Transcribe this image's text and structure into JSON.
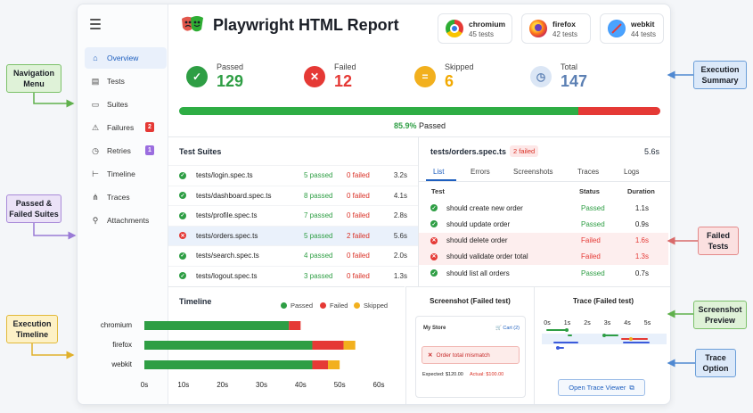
{
  "app": {
    "title": "Playwright HTML Report"
  },
  "sidebar": {
    "items": [
      {
        "label": "Overview",
        "icon": "home-icon",
        "active": true
      },
      {
        "label": "Tests",
        "icon": "clipboard-icon"
      },
      {
        "label": "Suites",
        "icon": "folder-icon"
      },
      {
        "label": "Failures",
        "icon": "alert-icon",
        "badge": "2",
        "badge_color": "#e53935"
      },
      {
        "label": "Retries",
        "icon": "clock-icon",
        "badge": "1",
        "badge_color": "#9b6ddf"
      },
      {
        "label": "Timeline",
        "icon": "timeline-icon"
      },
      {
        "label": "Traces",
        "icon": "trace-icon"
      },
      {
        "label": "Attachments",
        "icon": "paperclip-icon"
      }
    ]
  },
  "browsers": [
    {
      "name": "chromium",
      "count": "45 tests",
      "icon": "chrome-icon"
    },
    {
      "name": "firefox",
      "count": "42 tests",
      "icon": "firefox-icon"
    },
    {
      "name": "webkit",
      "count": "44 tests",
      "icon": "safari-icon"
    }
  ],
  "summary": {
    "passed": {
      "label": "Passed",
      "value": "129",
      "color": "#2e9e44"
    },
    "failed": {
      "label": "Failed",
      "value": "12",
      "color": "#e53935"
    },
    "skipped": {
      "label": "Skipped",
      "value": "6",
      "color": "#f2a900"
    },
    "total": {
      "label": "Total",
      "value": "147",
      "color": "#5b7fb3"
    }
  },
  "progress": {
    "passed_fraction": 0.852,
    "failed_fraction": 0.174,
    "percent_text": "85.9%",
    "label": "Passed"
  },
  "suites": {
    "title": "Test Suites",
    "rows": [
      {
        "name": "tests/login.spec.ts",
        "passed": "5 passed",
        "failed": "0 failed",
        "duration": "3.2s",
        "status": "pass"
      },
      {
        "name": "tests/dashboard.spec.ts",
        "passed": "8 passed",
        "failed": "0 failed",
        "duration": "4.1s",
        "status": "pass"
      },
      {
        "name": "tests/profile.spec.ts",
        "passed": "7 passed",
        "failed": "0 failed",
        "duration": "2.8s",
        "status": "pass"
      },
      {
        "name": "tests/orders.spec.ts",
        "passed": "5 passed",
        "failed": "2 failed",
        "duration": "5.6s",
        "status": "fail",
        "selected": true
      },
      {
        "name": "tests/search.spec.ts",
        "passed": "4 passed",
        "failed": "0 failed",
        "duration": "2.0s",
        "status": "pass"
      },
      {
        "name": "tests/logout.spec.ts",
        "passed": "3 passed",
        "failed": "0 failed",
        "duration": "1.3s",
        "status": "pass"
      }
    ]
  },
  "detail": {
    "file": "tests/orders.spec.ts",
    "badge": "2 failed",
    "duration": "5.6s",
    "tabs": [
      "List",
      "Errors",
      "Screenshots",
      "Traces",
      "Logs"
    ],
    "columns": {
      "test": "Test",
      "status": "Status",
      "duration": "Duration"
    },
    "rows": [
      {
        "name": "should create new order",
        "status": "Passed",
        "duration": "1.1s",
        "state": "pass"
      },
      {
        "name": "should update order",
        "status": "Passed",
        "duration": "0.9s",
        "state": "pass"
      },
      {
        "name": "should delete order",
        "status": "Failed",
        "duration": "1.6s",
        "state": "fail"
      },
      {
        "name": "should validate order total",
        "status": "Failed",
        "duration": "1.3s",
        "state": "fail"
      },
      {
        "name": "should list all orders",
        "status": "Passed",
        "duration": "0.7s",
        "state": "pass"
      }
    ]
  },
  "timeline": {
    "title": "Timeline",
    "legend": [
      "Passed",
      "Failed",
      "Skipped"
    ],
    "colors": {
      "passed": "#2e9e44",
      "failed": "#e53935",
      "skipped": "#f2b01e"
    },
    "ticks": [
      "0s",
      "10s",
      "20s",
      "30s",
      "40s",
      "50s",
      "60s"
    ],
    "x_max": 60,
    "rows": [
      {
        "label": "chromium",
        "passed": 37,
        "failed": 3,
        "skipped": 0
      },
      {
        "label": "firefox",
        "passed": 43,
        "failed": 8,
        "skipped": 3
      },
      {
        "label": "webkit",
        "passed": 43,
        "failed": 4,
        "skipped": 3
      }
    ]
  },
  "screenshot": {
    "title": "Screenshot (Failed test)",
    "store": "My Store",
    "cart": "Cart (2)",
    "error": "Order total mismatch",
    "expected": "Expected: $120.00",
    "actual": "Actual: $100.00"
  },
  "trace": {
    "title": "Trace (Failed test)",
    "ticks": [
      "0s",
      "1s",
      "2s",
      "3s",
      "4s",
      "5s"
    ],
    "button": "Open Trace Viewer"
  },
  "callouts": {
    "navigation": "Navigation Menu",
    "suites": "Passed & Failed Suites",
    "timeline": "Execution Timeline",
    "summary": "Execution Summary",
    "failed": "Failed Tests",
    "screenshot": "Screenshot Preview",
    "trace": "Trace Option"
  }
}
